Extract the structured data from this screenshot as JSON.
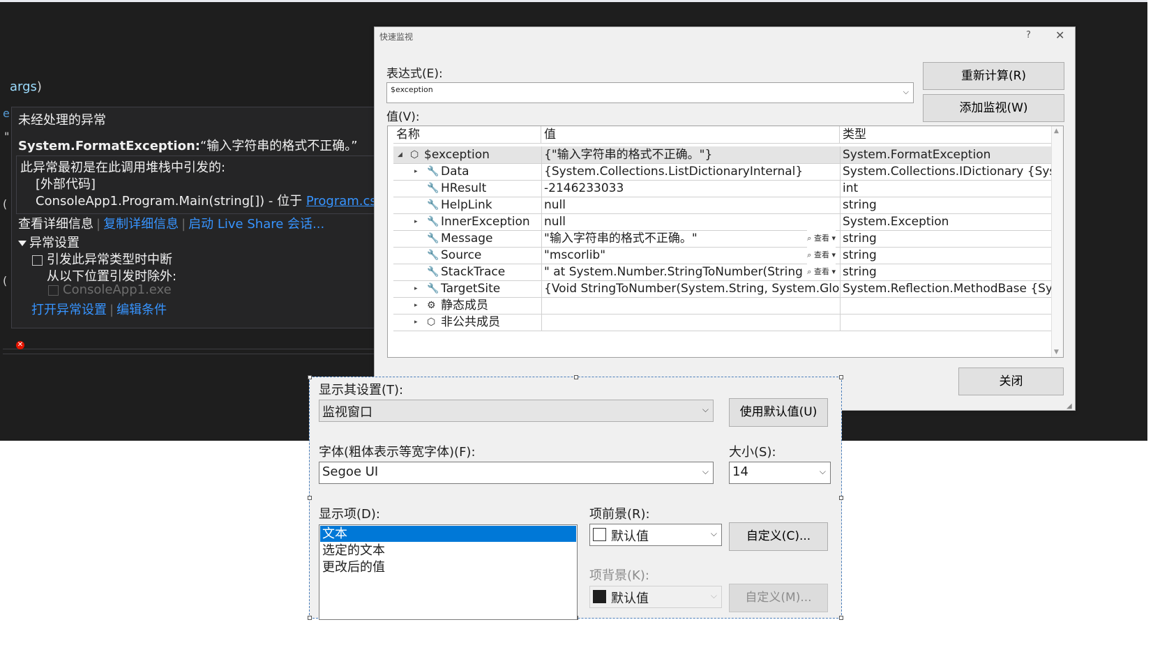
{
  "ide": {
    "code_args": "args",
    "code_paren": ")",
    "frag_e": "e",
    "frag_quote": "\"",
    "frag_paren1": "(",
    "frag_paren2": "(",
    "error_glyph": "✕"
  },
  "exception_popup": {
    "title": "未经处理的异常",
    "type": "System.FormatException:",
    "message": "“输入字符串的格式不正确。”",
    "stack_header": "此异常最初是在此调用堆栈中引发的:",
    "stack_external": "[外部代码]",
    "stack_main_text": "ConsoleApp1.Program.Main(string[]) - 位于 ",
    "stack_main_link": "Program.cs",
    "actions": [
      "查看详细信息",
      "复制详细信息",
      "启动 Live Share 会话..."
    ],
    "settings_title": "异常设置",
    "break_label": "引发此异常类型时中断",
    "except_label": "从以下位置引发时除外:",
    "consoleapp_label": "ConsoleApp1.exe",
    "bottom_actions": [
      "打开异常设置",
      "编辑条件"
    ]
  },
  "quickwatch": {
    "title": "快速监视",
    "help": "?",
    "close_x": "✕",
    "expression_label": "表达式(E):",
    "expression_value": "$exception",
    "value_label": "值(V):",
    "recalc_button": "重新计算(R)",
    "add_watch_button": "添加监视(W)",
    "close_button": "关闭",
    "columns": [
      "名称",
      "值",
      "类型"
    ],
    "viewer_label": "查看",
    "rows": [
      {
        "name": "$exception",
        "value": "{\"输入字符串的格式不正确。\"}",
        "type": "System.FormatException",
        "expand": "◢",
        "icon": "exception-icon"
      },
      {
        "name": "Data",
        "value": "{System.Collections.ListDictionaryInternal}",
        "type": "System.Collections.IDictionary {Syst...",
        "expand": "▸",
        "icon": "property-icon"
      },
      {
        "name": "HResult",
        "value": "-2146233033",
        "type": "int",
        "expand": "",
        "icon": "property-icon"
      },
      {
        "name": "HelpLink",
        "value": "null",
        "type": "string",
        "expand": "",
        "icon": "property-icon"
      },
      {
        "name": "InnerException",
        "value": "null",
        "type": "System.Exception",
        "expand": "▸",
        "icon": "property-icon"
      },
      {
        "name": "Message",
        "value": "\"输入字符串的格式不正确。\"",
        "type": "string",
        "expand": "",
        "icon": "property-icon",
        "viewer": true
      },
      {
        "name": "Source",
        "value": "\"mscorlib\"",
        "type": "string",
        "expand": "",
        "icon": "property-icon",
        "viewer": true
      },
      {
        "name": "StackTrace",
        "value": "\"   at System.Number.StringToNumber(String ...",
        "type": "string",
        "expand": "",
        "icon": "property-icon",
        "viewer": true
      },
      {
        "name": "TargetSite",
        "value": "{Void StringToNumber(System.String, System.Globali...",
        "type": "System.Reflection.MethodBase {Syst...",
        "expand": "▸",
        "icon": "property-icon"
      },
      {
        "name": "静态成员",
        "value": "",
        "type": "",
        "expand": "▸",
        "icon": "static-members-icon"
      },
      {
        "name": "非公共成员",
        "value": "",
        "type": "",
        "expand": "▸",
        "icon": "nonpublic-members-icon"
      }
    ]
  },
  "options": {
    "show_settings_label": "显示其设置(T):",
    "show_settings_value": "监视窗口",
    "use_defaults_button": "使用默认值(U)",
    "font_label": "字体(粗体表示等宽字体)(F):",
    "font_value": "Segoe UI",
    "size_label": "大小(S):",
    "size_value": "14",
    "display_items_label": "显示项(D):",
    "display_items": [
      "文本",
      "选定的文本",
      "更改后的值"
    ],
    "selected_index": 0,
    "fg_label": "项前景(R):",
    "fg_value": "默认值",
    "fg_custom_button": "自定义(C)...",
    "bg_label": "项背景(K):",
    "bg_value": "默认值",
    "bg_custom_button": "自定义(M)...",
    "fg_swatch_color": "#ffffff",
    "bg_swatch_color": "#1e1e1e"
  },
  "colors": {
    "ide_background": "#1e1e1e",
    "link": "#3794ff",
    "selection": "#0078d7"
  }
}
